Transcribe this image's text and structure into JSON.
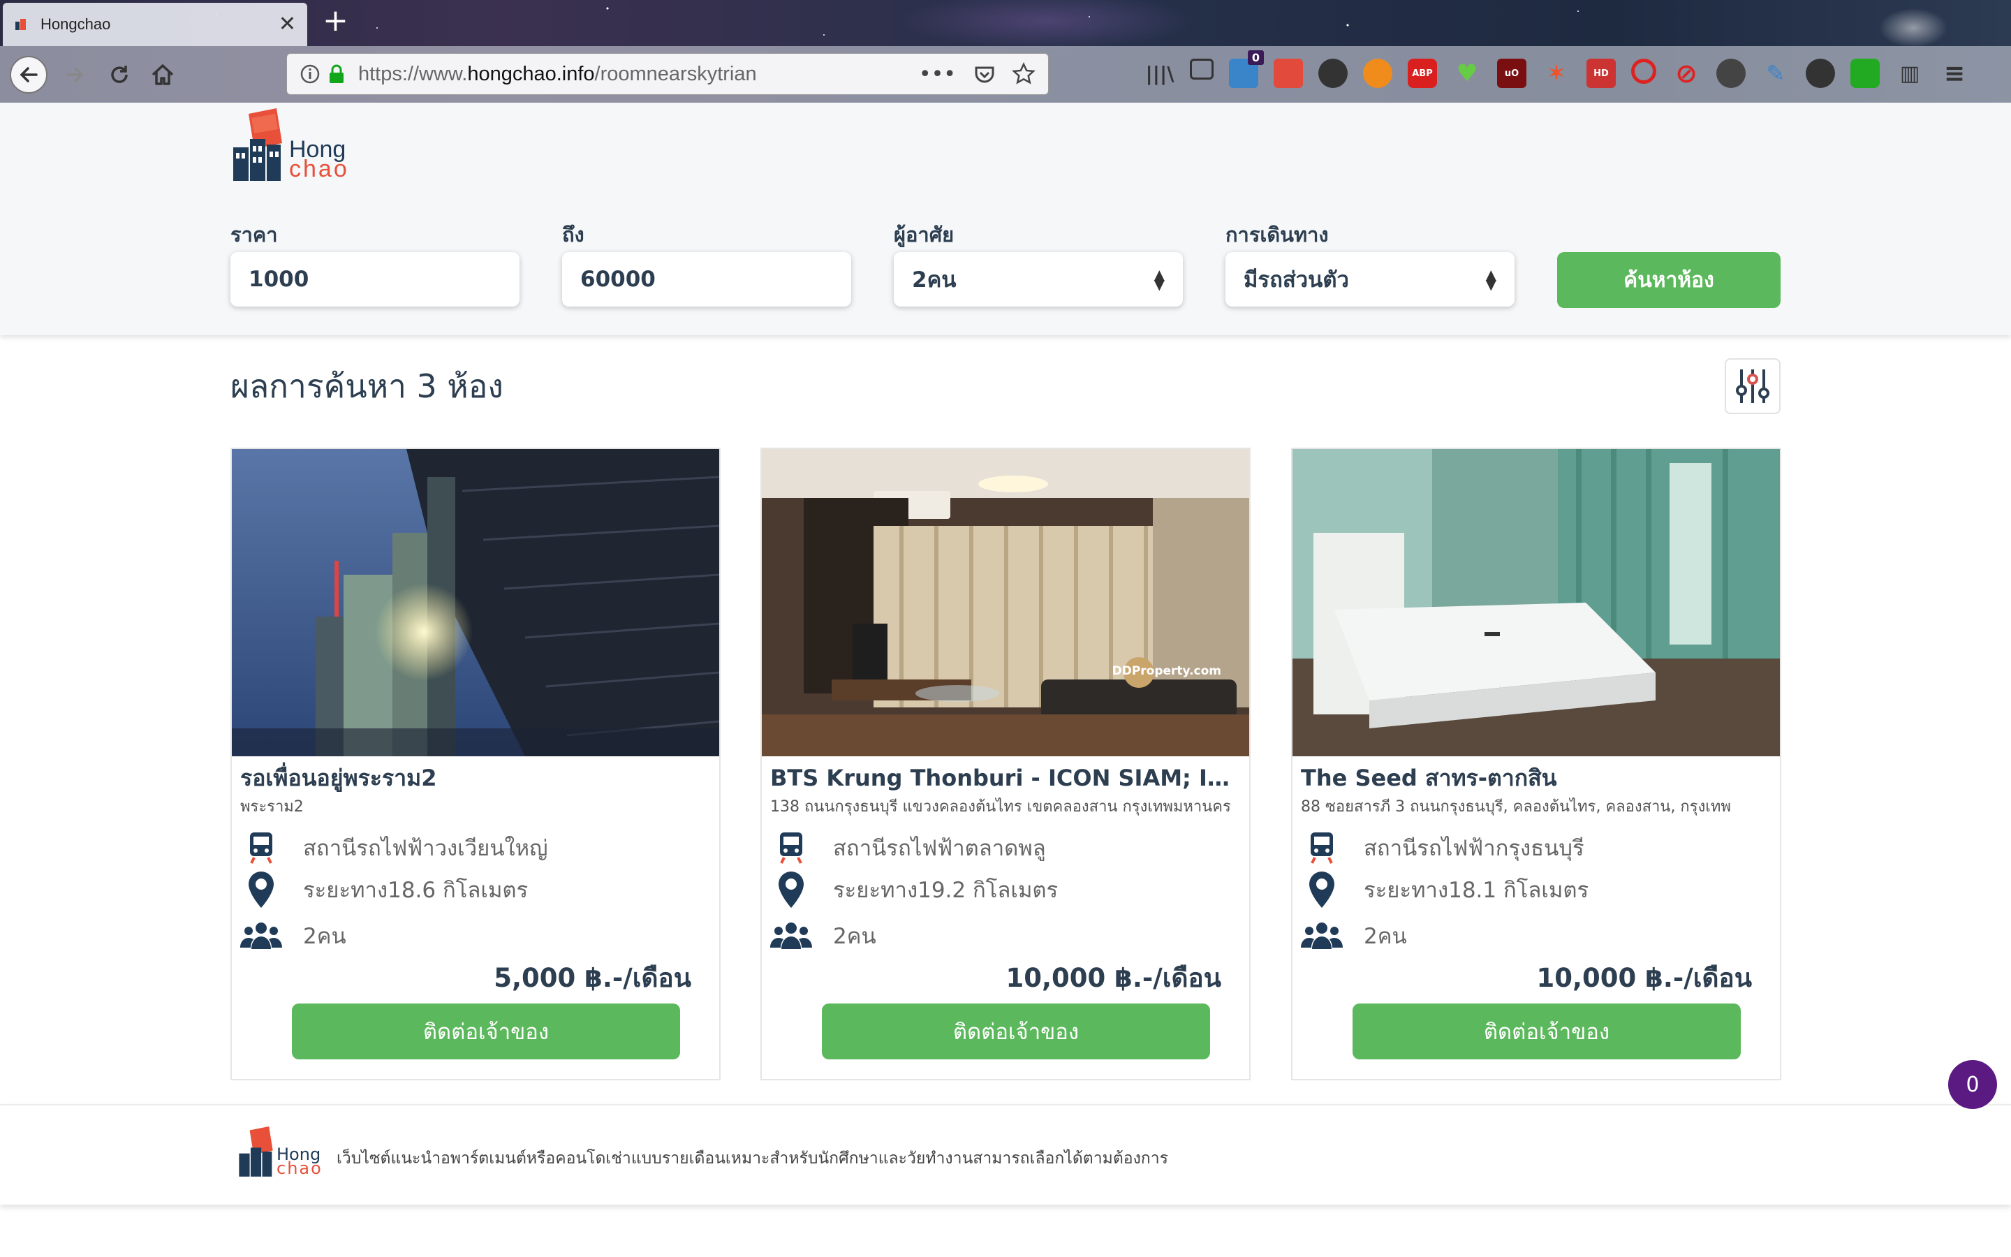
{
  "browser": {
    "tab_title": "Hongchao",
    "url_prefix": "https://www.",
    "url_domain": "hongchao.info",
    "url_path": "/roomnearskytrian",
    "badge_count": "0"
  },
  "site": {
    "logo_line1": "Hong",
    "logo_line2": "chao"
  },
  "search": {
    "price_from_label": "ราคา",
    "price_from_value": "1000",
    "price_to_label": "ถึง",
    "price_to_value": "60000",
    "residents_label": "ผู้อาศัย",
    "residents_value": "2คน",
    "travel_label": "การเดินทาง",
    "travel_value": "มีรถส่วนตัว",
    "button_label": "ค้นหาห้อง"
  },
  "results": {
    "title": "ผลการค้นหา 3 ห้อง",
    "rooms": [
      {
        "name": "รอเพื่อนอยู่พระราม2",
        "address": "พระราม2",
        "station": "สถานีรถไฟฟ้าวงเวียนใหญ่",
        "distance": "ระยะทาง18.6 กิโลเมตร",
        "residents": "2คน",
        "price": "5,000 ฿.-/เดือน",
        "contact_label": "ติดต่อเจ้าของ"
      },
      {
        "name": "BTS Krung Thonburi - ICON SIAM; IDEO สาทร-ตากสิน",
        "address": "138 ถนนกรุงธนบุรี แขวงคลองต้นไทร เขตคลองสาน กรุงเทพมหานคร",
        "station": "สถานีรถไฟฟ้าตลาดพลู",
        "distance": "ระยะทาง19.2 กิโลเมตร",
        "residents": "2คน",
        "price": "10,000 ฿.-/เดือน",
        "contact_label": "ติดต่อเจ้าของ",
        "watermark": "DDProperty.com"
      },
      {
        "name": "The Seed สาทร-ตากสิน",
        "address": "88 ซอยสารภี 3 ถนนกรุงธนบุรี, คลองต้นไทร, คลองสาน, กรุงเทพ",
        "station": "สถานีรถไฟฟ้ากรุงธนบุรี",
        "distance": "ระยะทาง18.1 กิโลเมตร",
        "residents": "2คน",
        "price": "10,000 ฿.-/เดือน",
        "contact_label": "ติดต่อเจ้าของ"
      }
    ]
  },
  "footer": {
    "text": "เว็บไซต์แนะนำอพาร์ตเมนต์หรือคอนโดเช่าแบบรายเดือนเหมาะสำหรับนักศึกษาและวัยทำงานสามารถเลือกได้ตามต้องการ"
  },
  "chat": {
    "count": "0"
  },
  "colors": {
    "primary": "#5cb85c",
    "heading": "#2c3e50",
    "logo_orange": "#e8503a",
    "logo_navy": "#1f3b57",
    "chat": "#5a1a82"
  }
}
